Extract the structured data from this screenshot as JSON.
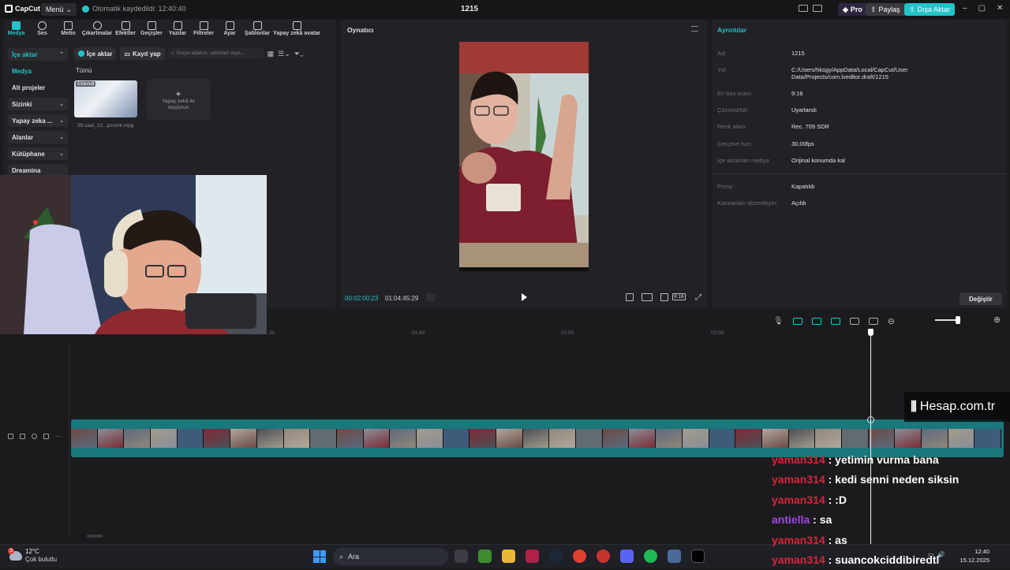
{
  "titlebar": {
    "app_name": "CapCut",
    "menu_label": "Menü",
    "autosave_text": "Otomatik kaydedildi: 12:40:40",
    "project_title": "1215",
    "pro_label": "Pro",
    "share_label": "Paylaş",
    "export_label": "Dışa Aktar",
    "accent_color": "#22c3c9"
  },
  "tools": [
    {
      "label": "Medya",
      "icon": "media-icon"
    },
    {
      "label": "Ses",
      "icon": "audio-icon"
    },
    {
      "label": "Metin",
      "icon": "text-icon"
    },
    {
      "label": "Çıkartmalar",
      "icon": "sticker-icon"
    },
    {
      "label": "Efektler",
      "icon": "effects-icon"
    },
    {
      "label": "Geçişler",
      "icon": "transitions-icon"
    },
    {
      "label": "Yazılar",
      "icon": "captions-icon"
    },
    {
      "label": "Filtreler",
      "icon": "filters-icon"
    },
    {
      "label": "Ayar",
      "icon": "adjust-icon"
    },
    {
      "label": "Şablonlar",
      "icon": "templates-icon"
    },
    {
      "label": "Yapay zekâ avatar",
      "icon": "ai-avatar-icon"
    }
  ],
  "sidenav": [
    {
      "label": "İçe aktar"
    },
    {
      "label": "Medya"
    },
    {
      "label": "Alt projeler"
    },
    {
      "label": "Sizinki"
    },
    {
      "label": "Yapay zeka ..."
    },
    {
      "label": "Alanlar"
    },
    {
      "label": "Kütüphane"
    },
    {
      "label": "Dreamina"
    }
  ],
  "media": {
    "import_label": "İçe aktar",
    "record_label": "Kayıt yap",
    "search_placeholder": "Dosya adlarını, sahneleri veya...",
    "filter_label": "Tümü",
    "clip_tag": "Eklendi",
    "clip_name": "39.saat_10...pcomtr.mpg",
    "ai_create_label": "Yapay zekâ ile oluşturun"
  },
  "player": {
    "title": "Oynatıcı",
    "current_time": "00:02:00:23",
    "total_time": "01:04:45:29",
    "ratio_label": "9:16"
  },
  "details": {
    "title": "Ayrıntılar",
    "rows": [
      {
        "key": "Ad:",
        "value": "1215"
      },
      {
        "key": "Yol:",
        "value": "C:/Users/hksgy/AppData/Local/CapCut/User Data/Projects/com.lveditor.draft/1215"
      },
      {
        "key": "En boy oranı:",
        "value": "9:16"
      },
      {
        "key": "Çözünürlük:",
        "value": "Uyarlandı"
      },
      {
        "key": "Renk alanı:",
        "value": "Rec. 709 SDR"
      },
      {
        "key": "Çerçeve hızı:",
        "value": "30.00fps"
      },
      {
        "key": "İçe aktarılan medya:",
        "value": "Orijinal konumda kal"
      },
      {
        "key": "Proxy:",
        "value": "Kapatıldı"
      },
      {
        "key": "Katmanları düzenleyin:",
        "value": "Açıldı"
      }
    ],
    "change_label": "Değiştir"
  },
  "timeline": {
    "ticks": [
      "01:20",
      "01:30",
      "01:40",
      "01:50",
      "02:00"
    ]
  },
  "watermark": "Hesap.com.tr",
  "chat": [
    {
      "user": "yaman314",
      "message": "yetimin vurma bana",
      "color": "#d9243a"
    },
    {
      "user": "yaman314",
      "message": "kedi senni neden siksin",
      "color": "#d9243a"
    },
    {
      "user": "yaman314",
      "message": ":D",
      "color": "#d9243a"
    },
    {
      "user": "antiella",
      "message": "sa",
      "color": "#a046e6"
    },
    {
      "user": "yaman314",
      "message": "as",
      "color": "#d9243a"
    },
    {
      "user": "yaman314",
      "message": "suancokciddibiredtl",
      "color": "#d9243a"
    }
  ],
  "taskbar": {
    "temperature": "12°C",
    "weather": "Çok bulutlu",
    "weather_badge": "3",
    "search_label": "Ara",
    "time": "12:40",
    "date": "15.12.2025"
  }
}
